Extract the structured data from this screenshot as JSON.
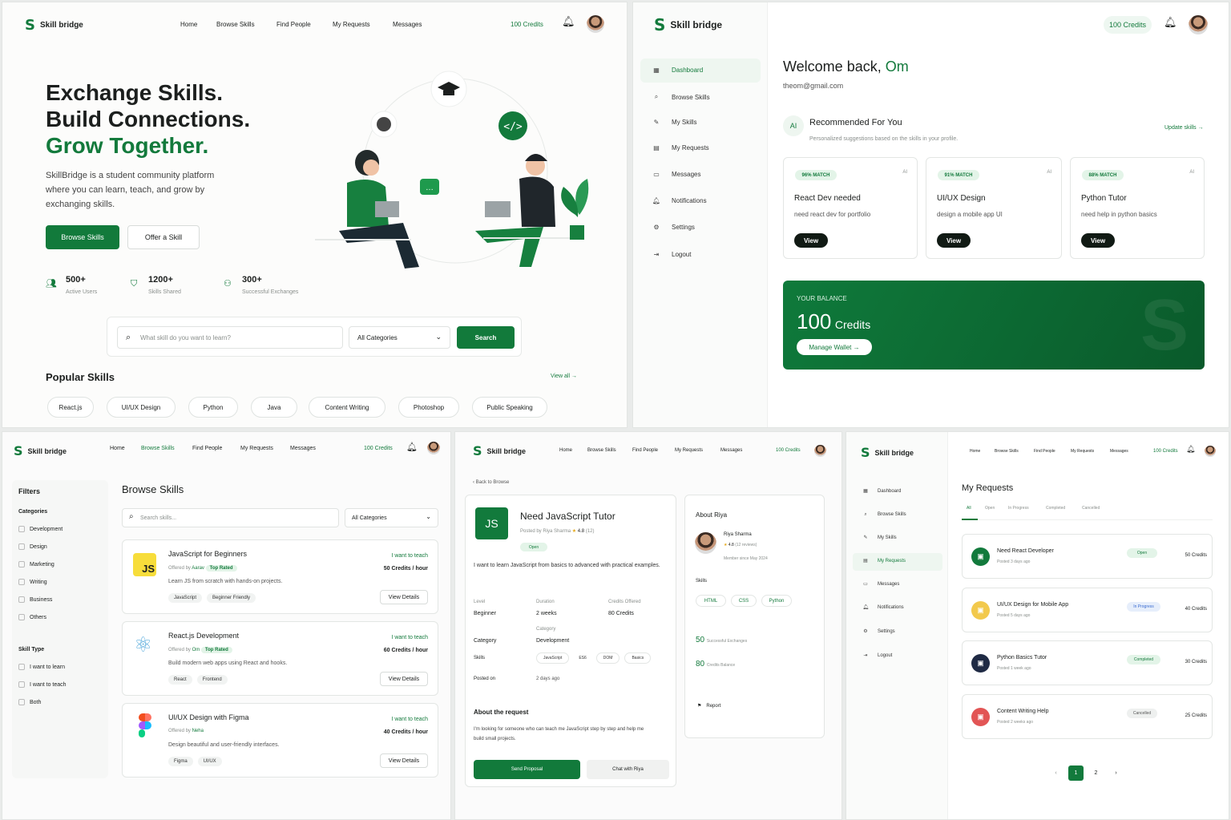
{
  "colors": {
    "accent": "#127a3c",
    "dark": "#111a14",
    "yellow": "#f2c94c",
    "red": "#e25555",
    "navy": "#1f2a44"
  },
  "brand": "Skill bridge",
  "nav": {
    "home": "Home",
    "browse": "Browse Skills",
    "people": "Find People",
    "requests": "My Requests",
    "messages": "Messages",
    "credits": "100 Credits"
  },
  "landing": {
    "h1": "Exchange Skills.",
    "h2": "Build Connections.",
    "h3": "Grow Together.",
    "desc": "SkillBridge is a student community platform where you can learn, teach, and grow by exchanging skills.",
    "browse_btn": "Browse Skills",
    "offer_btn": "Offer a Skill",
    "stats": [
      {
        "num": "500+",
        "label": "Active Users",
        "icon": "users-icon"
      },
      {
        "num": "1200+",
        "label": "Skills Shared",
        "icon": "shield-icon"
      },
      {
        "num": "300+",
        "label": "Successful Exchanges",
        "icon": "handshake-icon"
      }
    ],
    "search_placeholder": "What skill do you want to learn?",
    "category": "All Categories",
    "search_btn": "Search",
    "popular_title": "Popular Skills",
    "view_all": "View all →",
    "popular": [
      "React.js",
      "UI/UX Design",
      "Python",
      "Java",
      "Content Writing",
      "Photoshop",
      "Public Speaking"
    ]
  },
  "dashboard": {
    "credits": "100 Credits",
    "sidebar": [
      "Dashboard",
      "Browse Skills",
      "My Skills",
      "My Requests",
      "Messages",
      "Notifications",
      "Settings",
      "Logout"
    ],
    "welcome": "Welcome back,",
    "name": "Om",
    "email": "theom@gmail.com",
    "ai": "AI",
    "rec_title": "Recommended For You",
    "rec_sub": "Personalized suggestions based on the skills in your profile.",
    "update": "Update skills →",
    "recs": [
      {
        "match": "96% MATCH",
        "ai": "AI",
        "title": "React Dev needed",
        "desc": "need react dev for portfolio",
        "btn": "View"
      },
      {
        "match": "91% MATCH",
        "ai": "AI",
        "title": "UI/UX Design",
        "desc": "design a mobile app UI",
        "btn": "View"
      },
      {
        "match": "88% MATCH",
        "ai": "AI",
        "title": "Python Tutor",
        "desc": "need help in python basics",
        "btn": "View"
      }
    ],
    "balance_label": "YOUR BALANCE",
    "balance_num": "100",
    "balance_unit": "Credits",
    "wallet_btn": "Manage Wallet →"
  },
  "browse": {
    "filters": "Filters",
    "categories_label": "Categories",
    "categories": [
      "Development",
      "Design",
      "Marketing",
      "Writing",
      "Business",
      "Others"
    ],
    "skilltype_label": "Skill Type",
    "skilltypes": [
      "I want to learn",
      "I want to teach",
      "Both"
    ],
    "title": "Browse Skills",
    "search_placeholder": "Search skills...",
    "category": "All Categories",
    "items": [
      {
        "icon": "JS",
        "title": "JavaScript for Beginners",
        "offered": "Offered by",
        "by": "Aarav",
        "top": "Top Rated",
        "desc": "Learn JS from scratch with hands-on projects.",
        "tags": [
          "JavaScript",
          "Beginner Friendly"
        ],
        "intent": "I want to teach",
        "rate": "50 Credits / hour",
        "btn": "View Details"
      },
      {
        "icon": "⚛",
        "title": "React.js Development",
        "offered": "Offered by",
        "by": "Om",
        "top": "Top Rated",
        "desc": "Build modern web apps using React and hooks.",
        "tags": [
          "React",
          "Frontend"
        ],
        "intent": "I want to teach",
        "rate": "60 Credits / hour",
        "btn": "View Details"
      },
      {
        "icon": "F",
        "title": "UI/UX Design with Figma",
        "offered": "Offered by",
        "by": "Neha",
        "top": "",
        "desc": "Design beautiful and user-friendly interfaces.",
        "tags": [
          "Figma",
          "UI/UX"
        ],
        "intent": "I want to teach",
        "rate": "40 Credits / hour",
        "btn": "View Details"
      }
    ]
  },
  "detail": {
    "back": "‹ Back to Browse",
    "icon": "JS",
    "title": "Need JavaScript Tutor",
    "posted": "Posted by Riya Sharma",
    "rating": "4.8",
    "reviews": "(12)",
    "status": "Open",
    "desc": "I want to learn JavaScript from basics to advanced with practical examples.",
    "level_l": "Level",
    "level": "Beginner",
    "duration_l": "Duration",
    "duration": "2 weeks",
    "credits_l": "Credits Offered",
    "credits": "80 Credits",
    "category_l": "Category",
    "category": "Development",
    "skills_l": "Skills",
    "skills": [
      "JavaScript",
      "ES6",
      "DOM",
      "Basics"
    ],
    "posted_l": "Posted on",
    "posted_on": "2 days ago",
    "about_req": "About the request",
    "about_req_text": "I'm looking for someone who can teach me JavaScript step by step and help me build small projects.",
    "send": "Send Proposal",
    "chat": "Chat with Riya",
    "about_title": "About Riya",
    "person": "Riya Sharma",
    "p_rating": "4.8",
    "p_reviews": "(12 reviews)",
    "member": "Member since May 2024",
    "skills_title": "Skills",
    "p_skills": [
      "HTML",
      "CSS",
      "Python"
    ],
    "exch_num": "50",
    "exch_label": "Successful Exchanges",
    "bal_num": "80",
    "bal_label": "Credits Balance",
    "report": "Report"
  },
  "requests": {
    "sidebar": [
      "Dashboard",
      "Browse Skills",
      "My Skills",
      "My Requests",
      "Messages",
      "Notifications",
      "Settings",
      "Logout"
    ],
    "title": "My Requests",
    "tabs": [
      "All",
      "Open",
      "In Progress",
      "Completed",
      "Cancelled"
    ],
    "items": [
      {
        "title": "Need React Developer",
        "posted": "Posted 3 days ago",
        "status": "Open",
        "credits": "50 Credits"
      },
      {
        "title": "UI/UX Design for Mobile App",
        "posted": "Posted 5 days ago",
        "status": "In Progress",
        "credits": "40 Credits"
      },
      {
        "title": "Python Basics Tutor",
        "posted": "Posted 1 week ago",
        "status": "Completed",
        "credits": "30 Credits"
      },
      {
        "title": "Content Writing Help",
        "posted": "Posted 2 weeks ago",
        "status": "Cancelled",
        "credits": "25 Credits"
      }
    ],
    "pages": [
      "1",
      "2"
    ]
  }
}
